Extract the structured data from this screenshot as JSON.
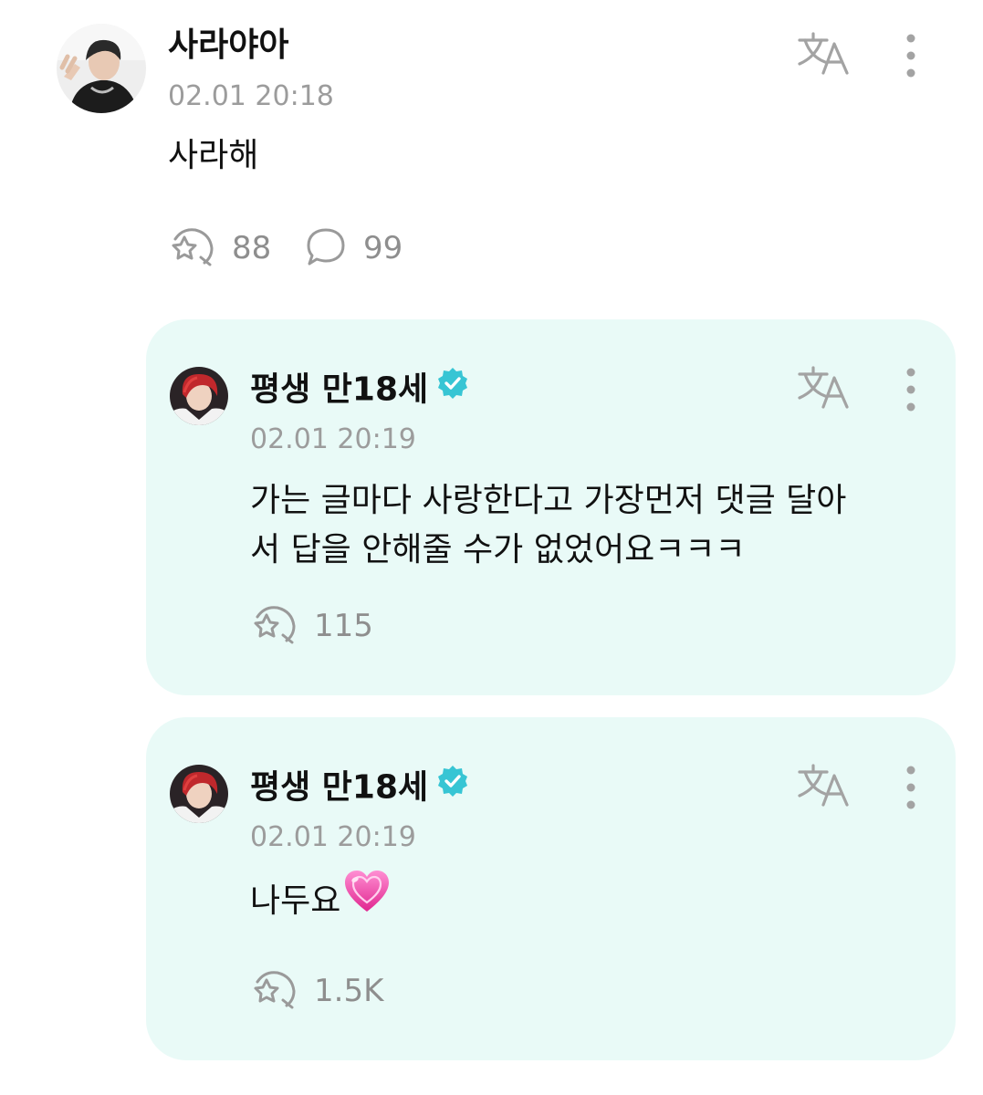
{
  "post": {
    "author": "사라야아",
    "timestamp": "02.01 20:18",
    "text": "사라해",
    "like_count": "88",
    "comment_count": "99",
    "icons": {
      "translate": "translate-icon",
      "more": "more-vertical-icon",
      "like": "like-star-icon",
      "comment": "comment-bubble-icon"
    }
  },
  "replies": [
    {
      "author": "평생 만18세",
      "verified": true,
      "timestamp": "02.01 20:19",
      "text_line1": "가는 글마다 사랑한다고 가장먼저 댓글 달아",
      "text_line2": "서 답을 안해줄 수가 없었어요ㅋㅋㅋ",
      "like_count": "115"
    },
    {
      "author": "평생 만18세",
      "verified": true,
      "timestamp": "02.01 20:19",
      "text": "나두요",
      "emoji": "💗",
      "like_count": "1.5K"
    }
  ],
  "colors": {
    "reply_background": "#e9faf7",
    "verified_badge": "#37c5d4",
    "icon_gray": "#9a9a9a",
    "secondary_text": "#9c9c9c"
  }
}
